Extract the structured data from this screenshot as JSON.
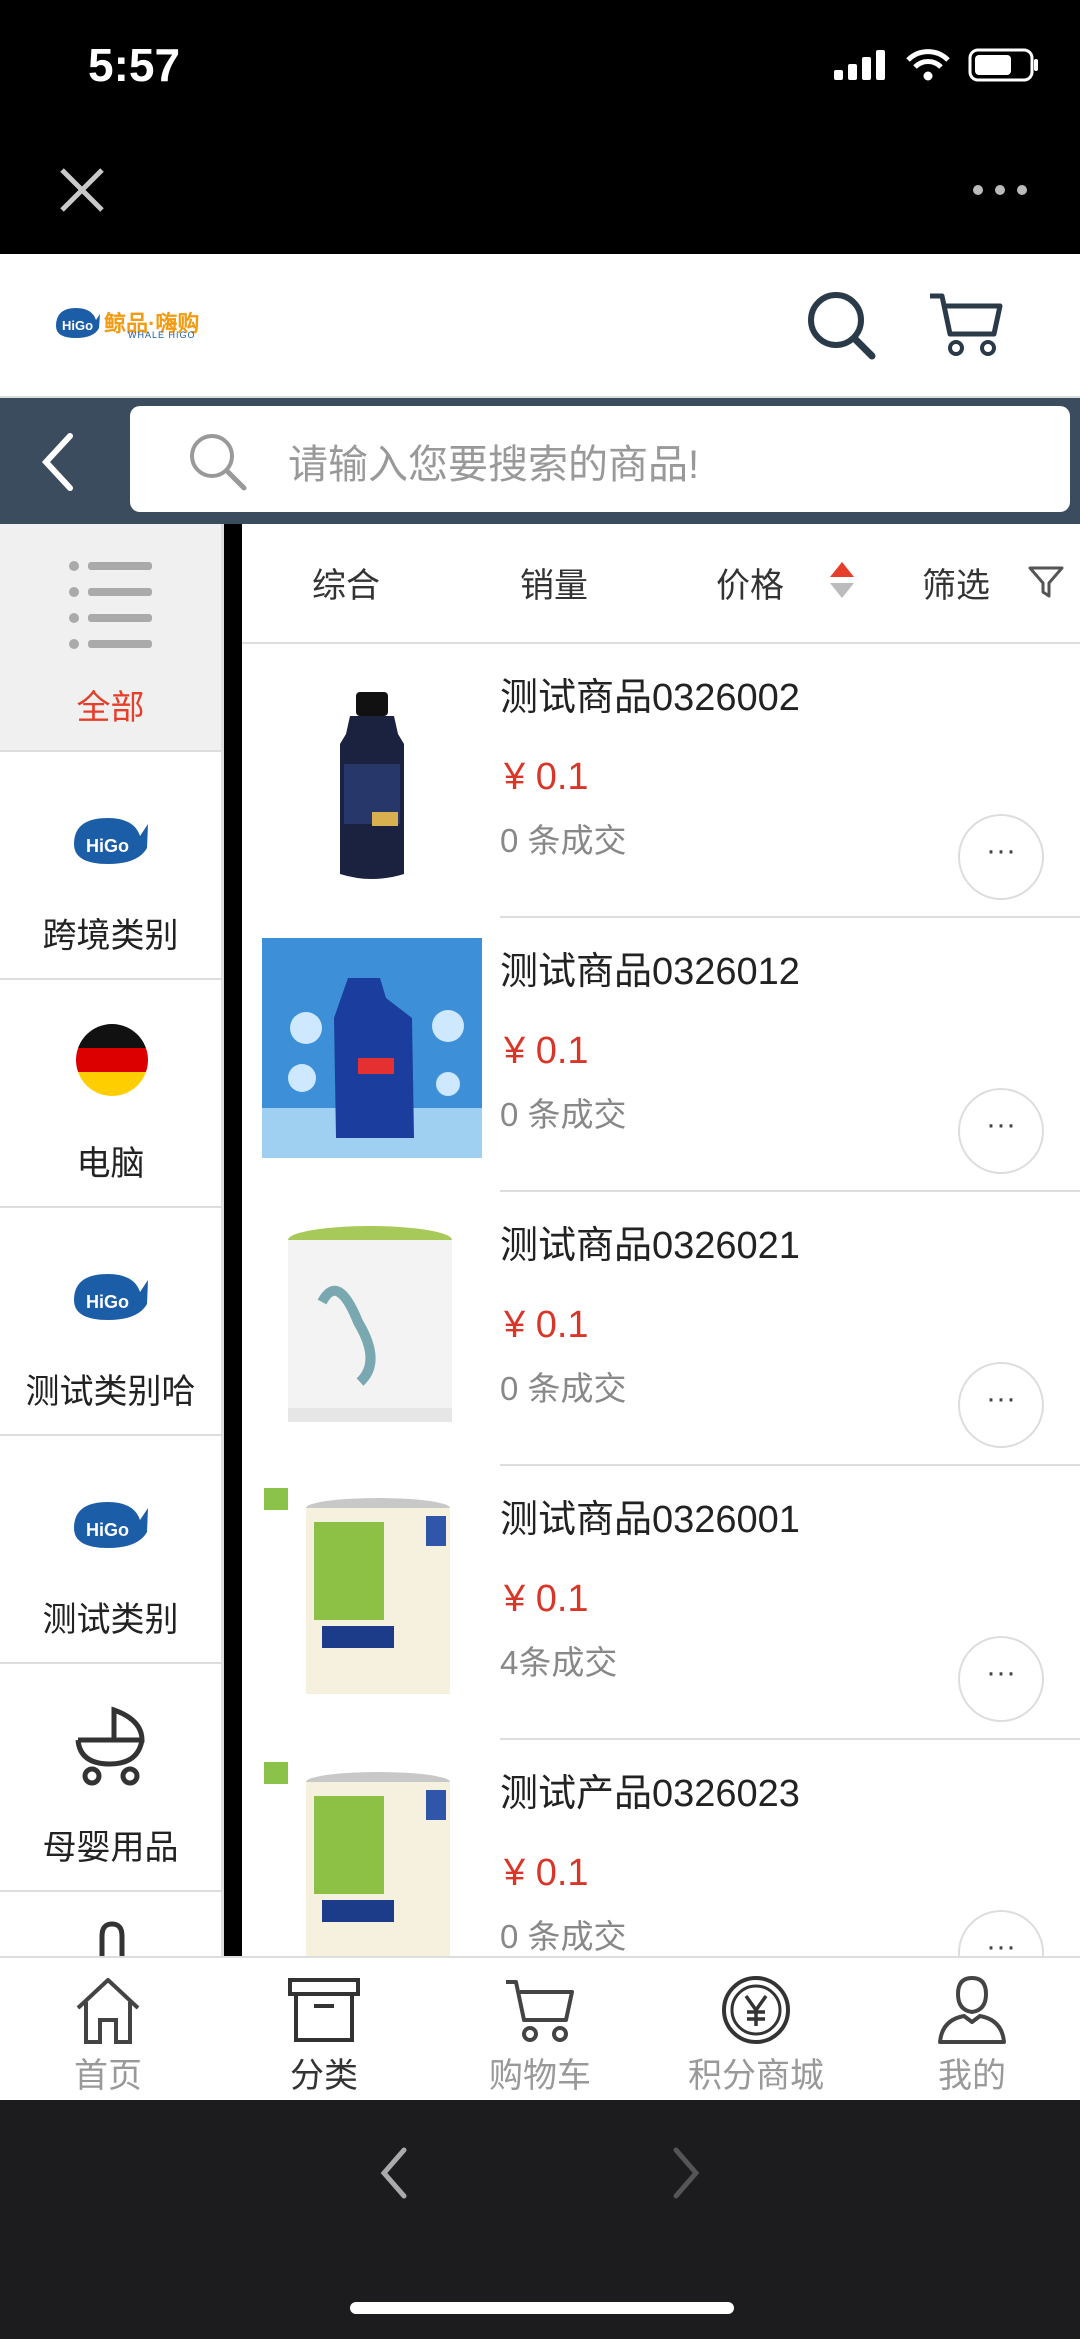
{
  "status_bar": {
    "time": "5:57"
  },
  "header": {
    "logo_text": "鲸品·嗨购",
    "logo_sub": "WHALE HIGO"
  },
  "search": {
    "placeholder": "请输入您要搜索的商品!"
  },
  "sidebar": {
    "items": [
      {
        "label": "全部",
        "icon": "list-icon",
        "active": true
      },
      {
        "label": "跨境类别",
        "icon": "higo-logo-icon",
        "active": false
      },
      {
        "label": "电脑",
        "icon": "germany-flag-icon",
        "active": false
      },
      {
        "label": "测试类别哈",
        "icon": "higo-logo-icon",
        "active": false
      },
      {
        "label": "测试类别",
        "icon": "higo-logo-icon",
        "active": false
      },
      {
        "label": "母婴用品",
        "icon": "stroller-icon",
        "active": false
      }
    ]
  },
  "filters": {
    "comprehensive": "综合",
    "sales": "销量",
    "price": "价格",
    "filter": "筛选"
  },
  "products": [
    {
      "name": "测试商品0326002",
      "price": "¥ 0.1",
      "sales": "0 条成交",
      "more": "···"
    },
    {
      "name": "测试商品0326012",
      "price": "¥ 0.1",
      "sales": "0 条成交",
      "more": "···"
    },
    {
      "name": "测试商品0326021",
      "price": "¥ 0.1",
      "sales": "0 条成交",
      "more": "···"
    },
    {
      "name": "测试商品0326001",
      "price": "¥ 0.1",
      "sales": "4条成交",
      "more": "···"
    },
    {
      "name": "测试产品0326023",
      "price": "¥ 0.1",
      "sales": "0 条成交",
      "more": "···"
    }
  ],
  "bottom_nav": [
    {
      "label": "首页",
      "icon": "home-icon"
    },
    {
      "label": "分类",
      "icon": "category-box-icon",
      "active": true
    },
    {
      "label": "购物车",
      "icon": "cart-icon"
    },
    {
      "label": "积分商城",
      "icon": "yen-coin-icon"
    },
    {
      "label": "我的",
      "icon": "user-icon"
    }
  ],
  "colors": {
    "accent": "#d9362a",
    "search_bar_bg": "#3a4c5e"
  }
}
